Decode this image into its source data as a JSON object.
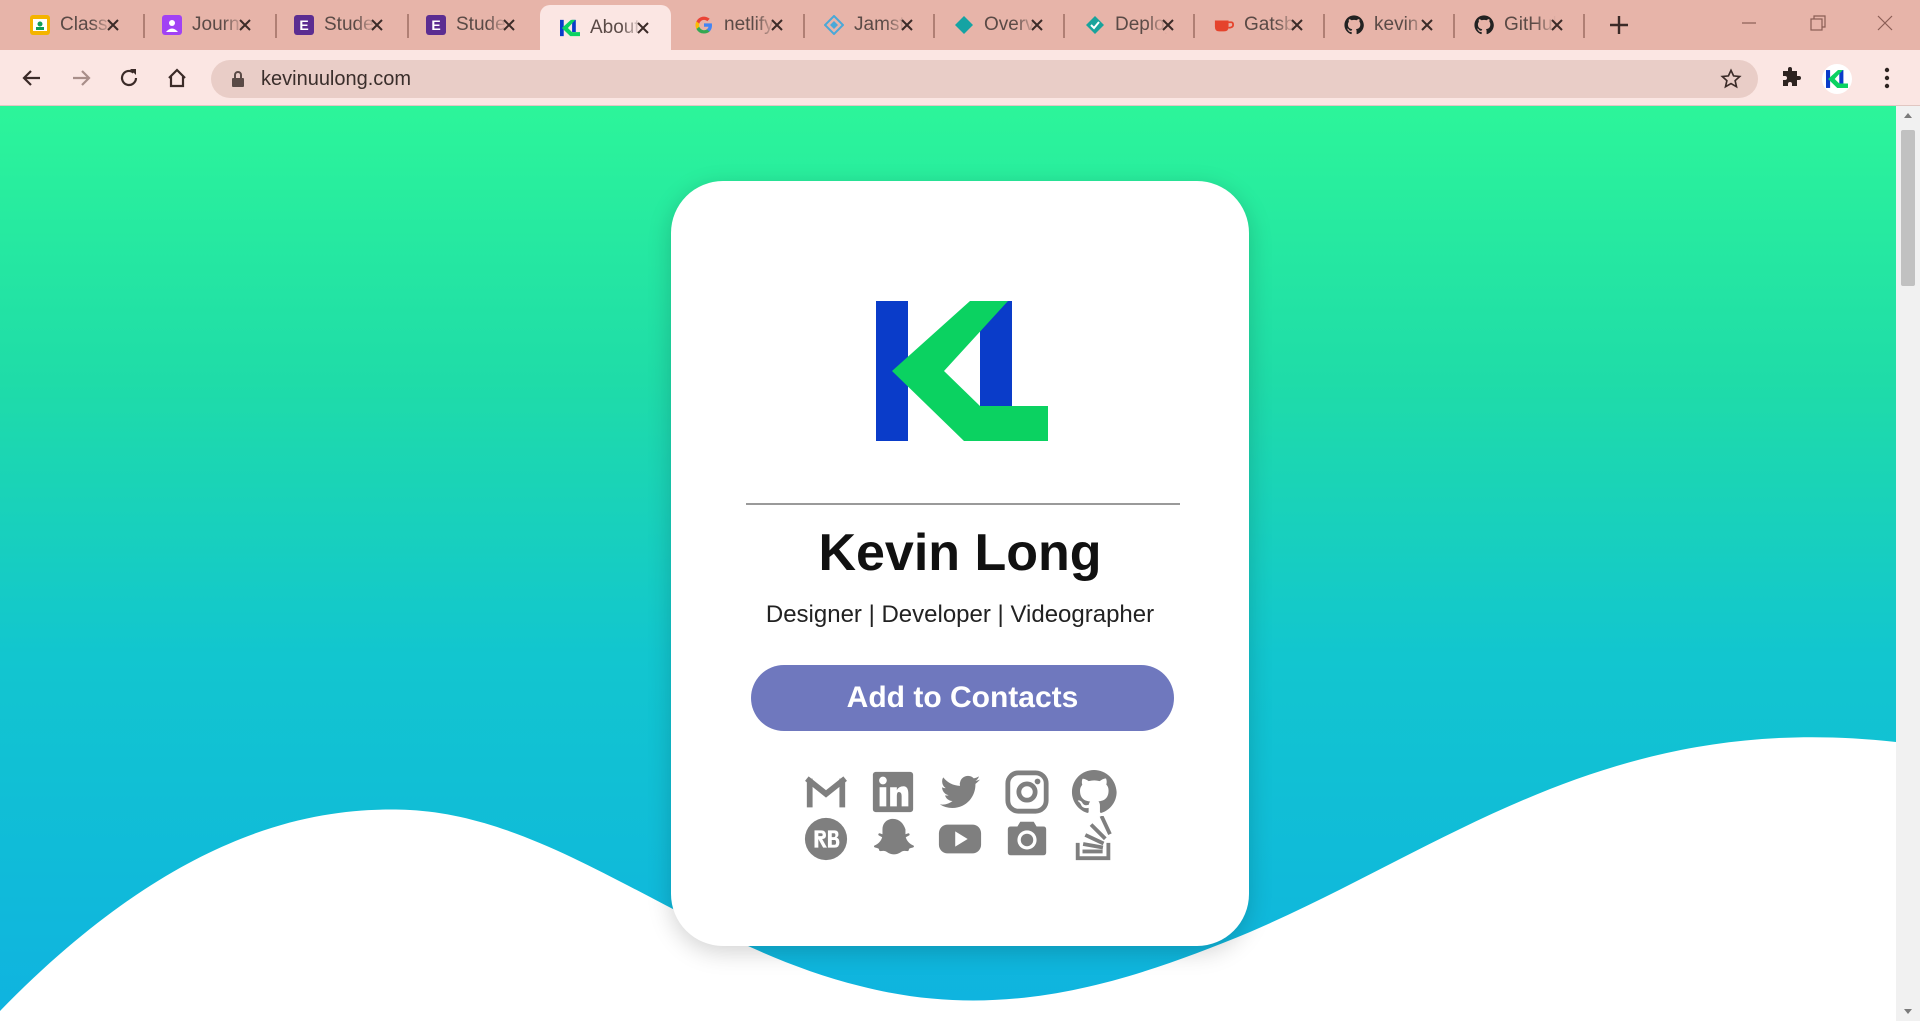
{
  "browser": {
    "tabs": [
      {
        "title": "Classroom",
        "icon": "google-classroom-icon",
        "color": "#f4b400"
      },
      {
        "title": "Journal",
        "icon": "person-icon",
        "color": "#a142f4"
      },
      {
        "title": "Student",
        "icon": "e-logo-icon",
        "color": "#5c2d91"
      },
      {
        "title": "Student",
        "icon": "e-logo-icon",
        "color": "#5c2d91"
      },
      {
        "title": "About",
        "icon": "kl-logo-icon",
        "color": "#0a3cc9"
      },
      {
        "title": "netlify",
        "icon": "google-icon",
        "color": "#4285f4"
      },
      {
        "title": "Jamstack",
        "icon": "jamstack-icon",
        "color": "#4aa8d8"
      },
      {
        "title": "Overview",
        "icon": "netlify-diamond-icon",
        "color": "#15a3a3"
      },
      {
        "title": "Deploy",
        "icon": "netlify-deploy-icon",
        "color": "#19a39c"
      },
      {
        "title": "Gatsby",
        "icon": "coffee-cup-icon",
        "color": "#e5432c"
      },
      {
        "title": "kevin",
        "icon": "github-icon",
        "color": "#222222"
      },
      {
        "title": "GitHub",
        "icon": "github-icon",
        "color": "#222222"
      }
    ],
    "active_tab_index": 4,
    "address": "kevinuulong.com"
  },
  "card": {
    "name": "Kevin Long",
    "subtitle": "Designer | Developer | Videographer",
    "add_button_label": "Add to Contacts",
    "button_color": "#6f78be",
    "logo_colors": {
      "blue": "#0a3cc9",
      "green": "#0bd261"
    },
    "socials": [
      {
        "name": "gmail-icon"
      },
      {
        "name": "linkedin-icon"
      },
      {
        "name": "twitter-icon"
      },
      {
        "name": "instagram-icon"
      },
      {
        "name": "github-icon"
      },
      {
        "name": "redbubble-icon"
      },
      {
        "name": "snapchat-icon"
      },
      {
        "name": "youtube-icon"
      },
      {
        "name": "camera-icon"
      },
      {
        "name": "stackoverflow-icon"
      }
    ]
  },
  "colors": {
    "gradient_top": "#2cf59a",
    "gradient_bottom": "#0fb3e0",
    "icon_gray": "#7f7f7f"
  }
}
